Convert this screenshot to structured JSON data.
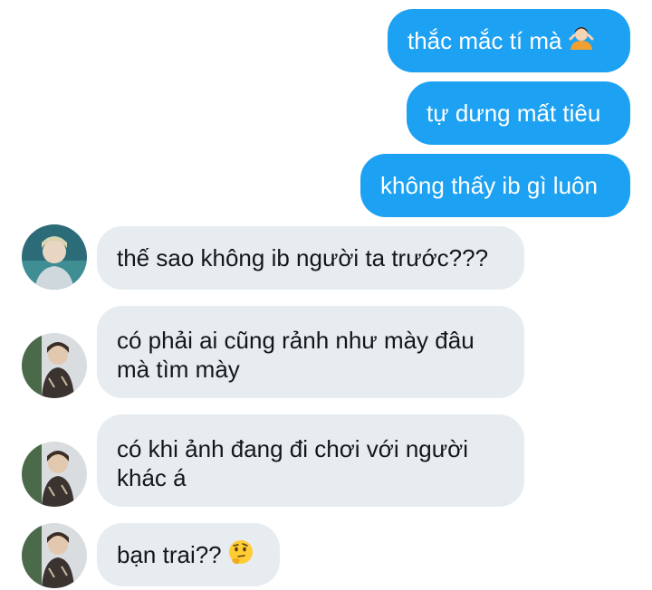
{
  "messages": {
    "sent": [
      {
        "text": "thắc mắc tí mà",
        "emoji": "person-shrugging-emoji"
      },
      {
        "text": "tự dưng mất tiêu"
      },
      {
        "text": "không thấy ib gì luôn"
      }
    ],
    "received": [
      {
        "text": "thế sao không ib người ta trước???",
        "avatar": "avatar-a"
      },
      {
        "line1": "có phải ai cũng rảnh như mày đâu",
        "line2": "mà tìm mày",
        "avatar": "avatar-b"
      },
      {
        "line1": "có khi ảnh đang đi chơi với người",
        "line2": "khác á",
        "avatar": "avatar-b"
      },
      {
        "text": "bạn trai??",
        "emoji": "thinking-face-emoji",
        "avatar": "avatar-b"
      }
    ]
  },
  "colors": {
    "sent_bubble": "#1da1f2",
    "received_bubble": "#e6ecf0",
    "received_text": "#14171a"
  }
}
